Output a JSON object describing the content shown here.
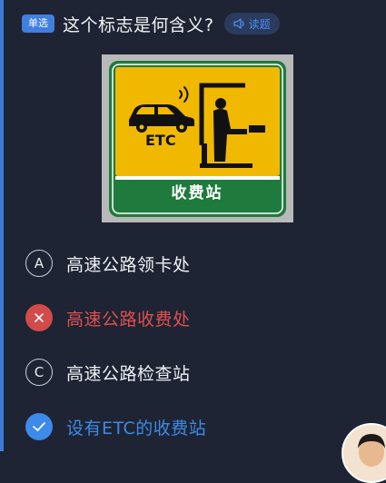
{
  "question": {
    "badge": "单选",
    "text": "这个标志是何含义?",
    "read_label": "读题"
  },
  "sign": {
    "etc_label": "ETC",
    "station_label": "收费站",
    "colors": {
      "frame": "#1f7a3d",
      "panel": "#f0b900",
      "border_light": "#ffffff",
      "background": "#b9b9b9"
    }
  },
  "options": [
    {
      "marker": "A",
      "text": "高速公路领卡处",
      "state": "normal"
    },
    {
      "marker": "×",
      "text": "高速公路收费处",
      "state": "wrong"
    },
    {
      "marker": "C",
      "text": "高速公路检查站",
      "state": "normal"
    },
    {
      "marker": "✓",
      "text": "设有ETC的收费站",
      "state": "correct"
    }
  ],
  "colors": {
    "background": "#1e2433",
    "accent": "#3d8ae8",
    "wrong": "#d24a4a"
  }
}
